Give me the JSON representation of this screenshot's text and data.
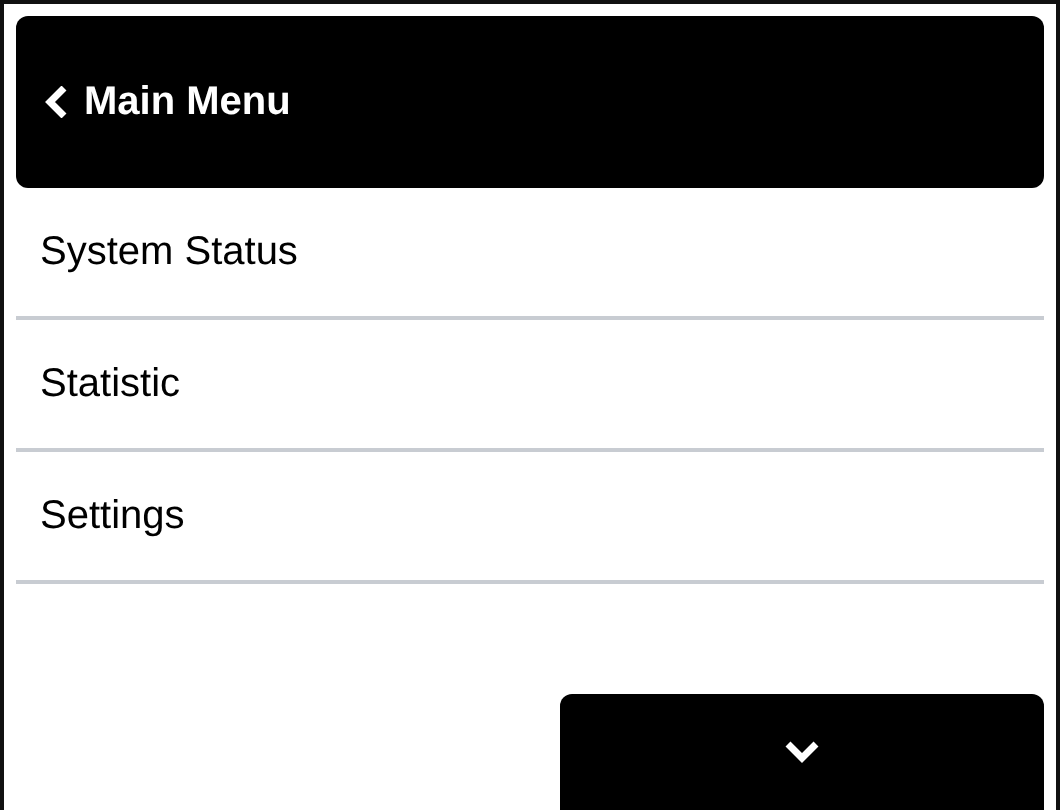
{
  "header": {
    "title": "Main Menu"
  },
  "menu_items": [
    {
      "label": "System Status"
    },
    {
      "label": "Statistic"
    },
    {
      "label": "Settings"
    }
  ]
}
